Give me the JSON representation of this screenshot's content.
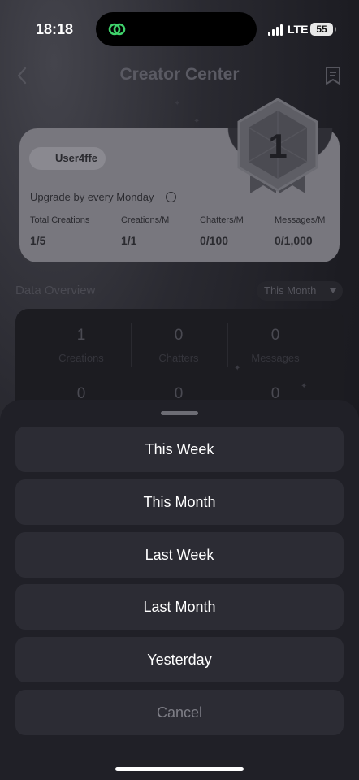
{
  "status_bar": {
    "time": "18:18",
    "network": "LTE",
    "battery": "55"
  },
  "nav": {
    "title": "Creator Center"
  },
  "profile_card": {
    "username": "User4ffe",
    "upgrade_text": "Upgrade by every Monday",
    "level": "1",
    "stats": [
      {
        "label": "Total Creations",
        "value": "1/5"
      },
      {
        "label": "Creations/M",
        "value": "1/1"
      },
      {
        "label": "Chatters/M",
        "value": "0/100"
      },
      {
        "label": "Messages/M",
        "value": "0/1,000"
      }
    ]
  },
  "data_overview": {
    "title": "Data Overview",
    "period": "This Month",
    "row1": [
      {
        "value": "1",
        "label": "Creations"
      },
      {
        "value": "0",
        "label": "Chatters"
      },
      {
        "value": "0",
        "label": "Messages"
      }
    ],
    "row2": [
      "0",
      "0",
      "0"
    ]
  },
  "period_sheet": {
    "options": [
      "This Week",
      "This Month",
      "Last Week",
      "Last Month",
      "Yesterday"
    ],
    "cancel": "Cancel"
  }
}
